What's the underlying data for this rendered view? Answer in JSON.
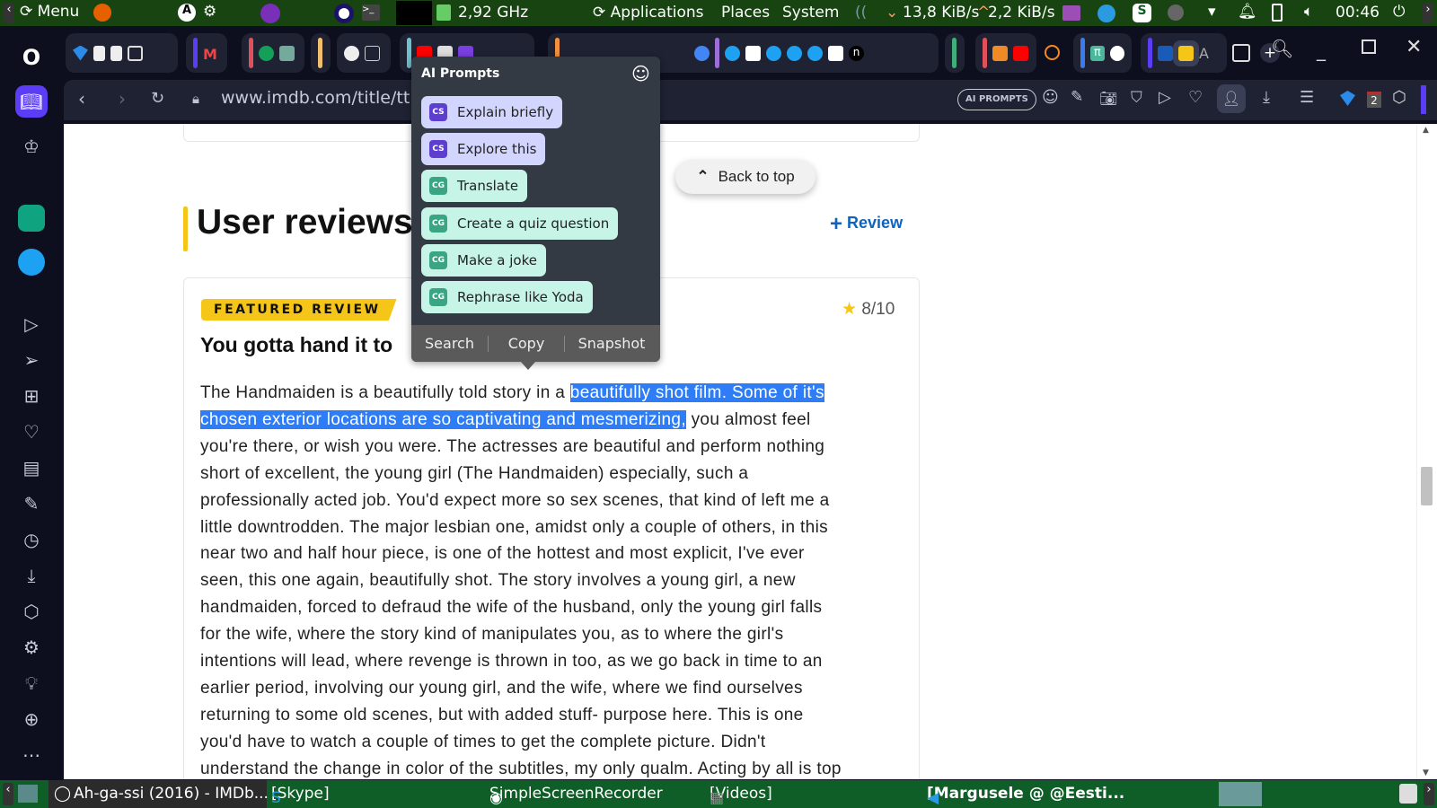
{
  "top_panel": {
    "menu": "Menu",
    "cpu": "2,92 GHz",
    "applications": "Applications",
    "places": "Places",
    "system": "System",
    "down": "13,8 KiB/s",
    "up": "2,2 KiB/s",
    "clock": "00:46"
  },
  "browser": {
    "url": "www.imdb.com/title/tt",
    "ai_prompts_button": "AI PROMPTS",
    "workspace_badge": "2"
  },
  "popup": {
    "title": "AI Prompts",
    "prompts": [
      {
        "badge": "CS",
        "label": "Explain briefly",
        "kind": "cs"
      },
      {
        "badge": "CS",
        "label": "Explore this",
        "kind": "cs"
      },
      {
        "badge": "CG",
        "label": "Translate",
        "kind": "cg"
      },
      {
        "badge": "CG",
        "label": "Create a quiz question",
        "kind": "cg"
      },
      {
        "badge": "CG",
        "label": "Make a joke",
        "kind": "cg"
      },
      {
        "badge": "CG",
        "label": "Rephrase like Yoda",
        "kind": "cg"
      }
    ],
    "actions": [
      "Search",
      "Copy",
      "Snapshot"
    ]
  },
  "page": {
    "section_title": "User reviews",
    "add_review": "Review",
    "back_to_top": "Back to top",
    "featured_badge": "FEATURED REVIEW",
    "rating": "8",
    "rating_max": "/10",
    "review_title": "You gotta hand it to ",
    "lines": [
      {
        "pre": "The Handmaiden is a beautifully told story in a ",
        "hl": "beautifully shot film. Some of it's",
        "post": ""
      },
      {
        "pre": "",
        "hl": "chosen exterior locations are so captivating and mesmerizing,",
        "post": " you almost feel"
      },
      {
        "pre": "you're there, or wish you were. The actresses are beautiful and perform nothing"
      },
      {
        "pre": "short of excellent, the young girl (The Handmaiden) especially, such a"
      },
      {
        "pre": "professionally acted job. You'd expect more so sex scenes, that kind of left me a"
      },
      {
        "pre": "little downtrodden. The major lesbian one, amidst only a couple of others, in this"
      },
      {
        "pre": "near two and half hour piece, is one of the hottest and most explicit, I've ever"
      },
      {
        "pre": "seen, this one again, beautifully shot. The story involves a young girl, a new"
      },
      {
        "pre": "handmaiden, forced to defraud the wife of the husband, only the young girl falls"
      },
      {
        "pre": "for the wife, where the story kind of manipulates you, as to where the girl's"
      },
      {
        "pre": "intentions will lead, where revenge is thrown in too, as we go back in time to an"
      },
      {
        "pre": "earlier period, involving our young girl, and the wife, where we find ourselves"
      },
      {
        "pre": "returning to some old scenes, but with added stuff- purpose here. This is one"
      },
      {
        "pre": "you'd have to watch a couple of times to get the complete picture. Didn't"
      },
      {
        "pre": "understand the change in color of the subtitles, my only qualm. Acting by all is top"
      }
    ]
  },
  "taskbar": {
    "items": [
      "Ah-ga-ssi (2016) - IMDb...",
      "[Skype]",
      "SimpleScreenRecorder",
      "[Videos]",
      "[Margusele @ @Eesti..."
    ]
  },
  "colors": {
    "highlight": "#2e7df7",
    "imdb_yellow": "#f5c518",
    "link": "#0e63be",
    "opera_accent": "#5b3df5"
  }
}
